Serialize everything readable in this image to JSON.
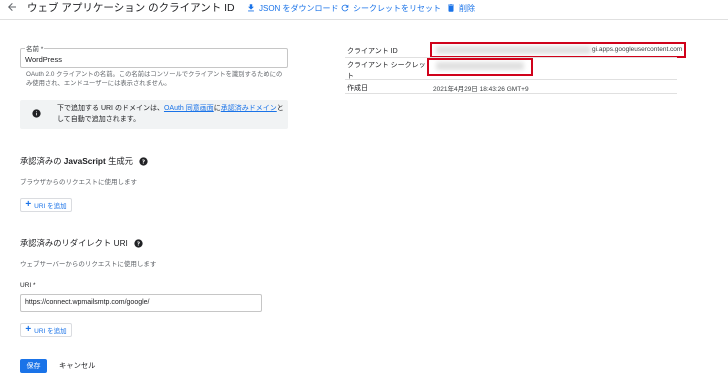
{
  "header": {
    "title": "ウェブ アプリケーション のクライアント ID",
    "actions": {
      "download_json": "JSON をダウンロード",
      "reset_secret": "シークレットをリセット",
      "delete": "削除"
    }
  },
  "name_field": {
    "label": "名前 *",
    "value": "WordPress",
    "help": "OAuth 2.0 クライアントの名前。この名前はコンソールでクライアントを識別するためにのみ使用され、エンドユーザーには表示されません。"
  },
  "info": {
    "text_before": "下で追加する URI のドメインは、",
    "link1": "OAuth 同意画面",
    "text_mid": "に",
    "link2": "承認済みドメイン",
    "text_after": "として自動で追加されます。"
  },
  "js_origins": {
    "title_prefix": "承認済みの ",
    "title_bold": "JavaScript",
    "title_suffix": " 生成元",
    "desc": "ブラウザからのリクエストに使用します",
    "add_button": "URI を追加"
  },
  "redirect": {
    "title": "承認済みのリダイレクト URI",
    "desc": "ウェブサーバーからのリクエストに使用します",
    "uri_label": "URI *",
    "uri_value": "https://connect.wpmailsmtp.com/google/",
    "add_button": "URI を追加"
  },
  "footer": {
    "save": "保存",
    "cancel": "キャンセル"
  },
  "details": {
    "client_id_label": "クライアント ID",
    "client_id_visible": "gi.apps.googleusercontent.com",
    "client_secret_label": "クライアント シークレット",
    "created_label": "作成日",
    "created_value": "2021年4月29日 18:43:26 GMT+9"
  },
  "colors": {
    "accent": "#1a73e8",
    "highlight": "#d0021b"
  }
}
